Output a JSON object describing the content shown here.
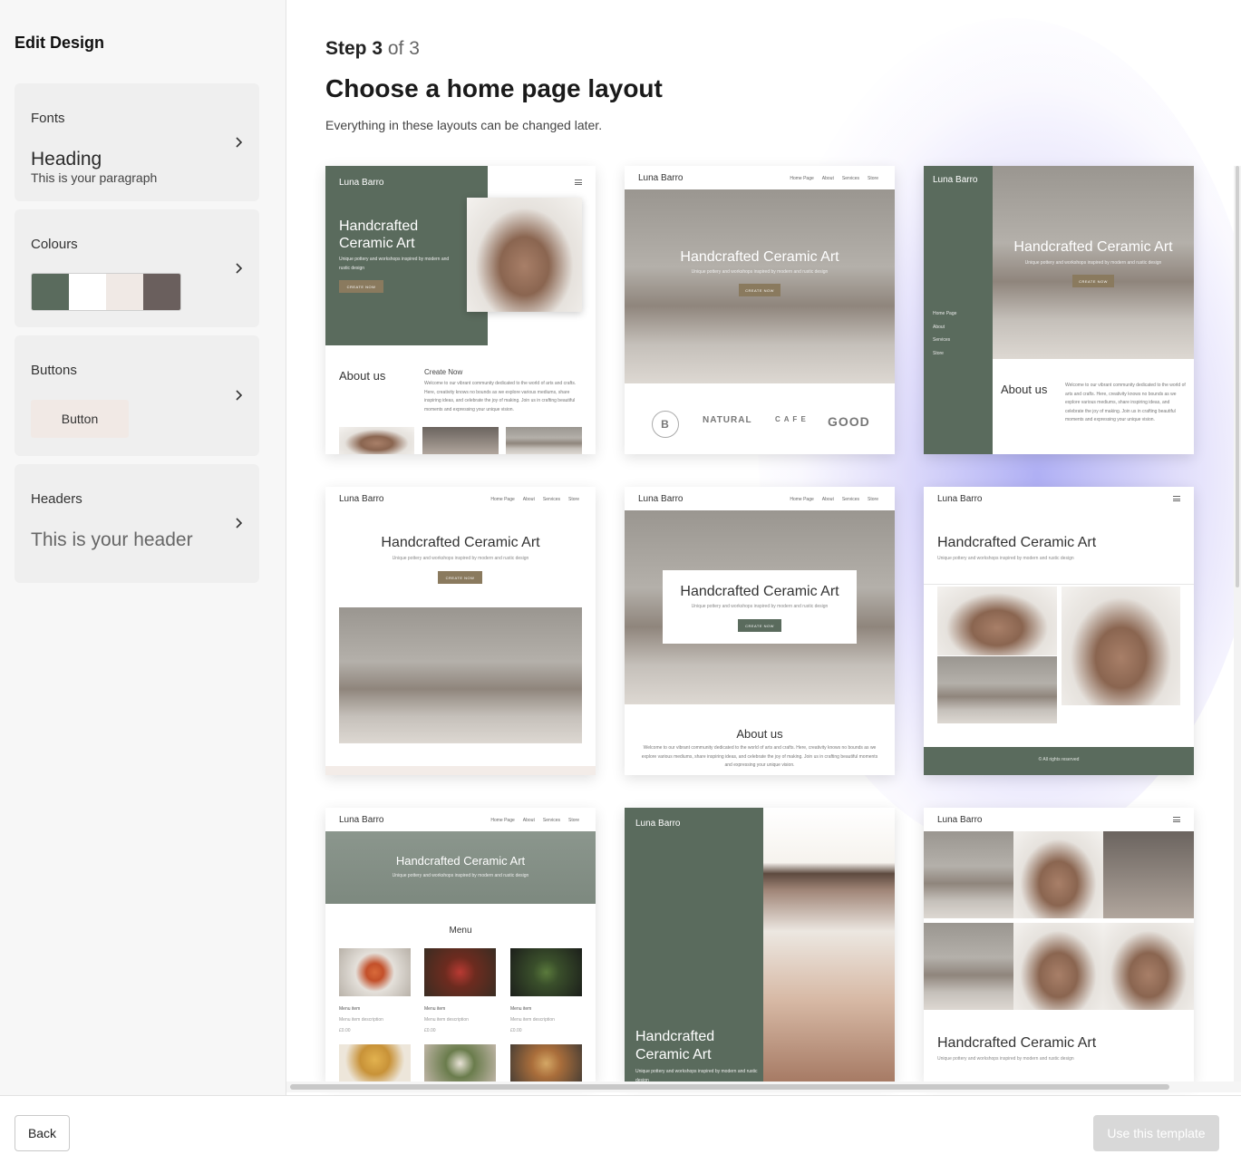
{
  "sidebar": {
    "title": "Edit Design",
    "fonts": {
      "label": "Fonts",
      "heading": "Heading",
      "paragraph": "This is your paragraph"
    },
    "colours": {
      "label": "Colours",
      "swatches": [
        "#5a6b5d",
        "#ffffff",
        "#f0e9e5",
        "#6a5f5d"
      ]
    },
    "buttons": {
      "label": "Buttons",
      "button_label": "Button"
    },
    "headers": {
      "label": "Headers",
      "sample": "This is your header"
    }
  },
  "main": {
    "step_current": "Step 3",
    "step_total": "of 3",
    "title": "Choose a home page layout",
    "subtitle": "Everything in these layouts can be changed later."
  },
  "template": {
    "brand": "Luna Barro",
    "nav": [
      "Home Page",
      "About",
      "Services",
      "Store"
    ],
    "hero_title": "Handcrafted Ceramic Art",
    "hero_title_line1": "Handcrafted",
    "hero_title_line2": "Ceramic Art",
    "hero_sub": "Unique pottery and workshops inspired by modern and rustic design",
    "cta": "CREATE NOW",
    "about": "About us",
    "create_now": "Create Now",
    "about_text": "Welcome to our vibrant community dedicated to the world of arts and crafts. Here, creativity knows no bounds as we explore various mediums, share inspiring ideas, and celebrate the joy of making. Join us in crafting beautiful moments and expressing your unique vision.",
    "footer_text": "© All rights reserved",
    "menu_title": "Menu",
    "menu_item": "Menu item",
    "menu_desc": "Menu item description",
    "menu_price": "£0.00",
    "logos": [
      "B",
      "NATURAL",
      "C A F E",
      "GOOD"
    ]
  },
  "colors": {
    "green": "#5a6b5d",
    "tan": "#8a7a5e",
    "panel": "#efefef"
  },
  "footer": {
    "back": "Back",
    "use": "Use this template"
  }
}
